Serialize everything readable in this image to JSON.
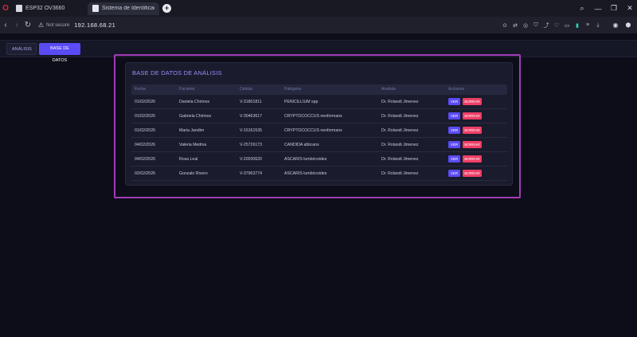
{
  "browser": {
    "tabs": [
      {
        "title": "ESP32 OV3660",
        "active": false
      },
      {
        "title": "Sistema de Identificación",
        "active": true
      }
    ],
    "security_label": "Not secure",
    "url": "192.168.68.21",
    "accent_color": "#e0233a"
  },
  "app": {
    "nav": {
      "tabs": [
        {
          "label": "ANÁLISIS",
          "active": false
        },
        {
          "label": "BASE DE DATOS",
          "active": true
        }
      ]
    },
    "card": {
      "title": "BASE DE DATOS DE ANÁLISIS",
      "columns": [
        "Fecha",
        "Paciente",
        "Cédula",
        "Patógeno",
        "Analista",
        "Acciones"
      ],
      "rows": [
        {
          "fecha": "01/02/2026",
          "paciente": "Daniela Chirinos",
          "cedula": "V-31801811",
          "patogeno": "PENICILLIUM spp",
          "analista": "Dr. Rolandi Jimenez"
        },
        {
          "fecha": "01/02/2026",
          "paciente": "Gabriela Chirinos",
          "cedula": "V-30463617",
          "patogeno": "CRYPTOCOCCUS neoformans",
          "analista": "Dr. Rolandi Jimenez"
        },
        {
          "fecha": "01/02/2026",
          "paciente": "Maria Jandim",
          "cedula": "V-15161535",
          "patogeno": "CRYPTOCOCCUS neoformans",
          "analista": "Dr. Rolandi Jimenez"
        },
        {
          "fecha": "04/02/2026",
          "paciente": "Valeria Medina",
          "cedula": "V-25726173",
          "patogeno": "CANDIDA albicans",
          "analista": "Dr. Rolandi Jimenez"
        },
        {
          "fecha": "04/02/2026",
          "paciente": "Rosa Leal",
          "cedula": "V-20030620",
          "patogeno": "ASCARIS lumbricoides",
          "analista": "Dr. Rolandi Jimenez"
        },
        {
          "fecha": "02/02/2026",
          "paciente": "Gonzalo Rivero",
          "cedula": "V-37963774",
          "patogeno": "ASCARIS lumbricoides",
          "analista": "Dr. Rolandi Jimenez"
        }
      ],
      "actions": {
        "view": "VER",
        "delete": "BORRAR"
      }
    },
    "colors": {
      "primary": "#5b4bf5",
      "danger": "#f03e66",
      "highlight": "#a23bb7"
    }
  }
}
